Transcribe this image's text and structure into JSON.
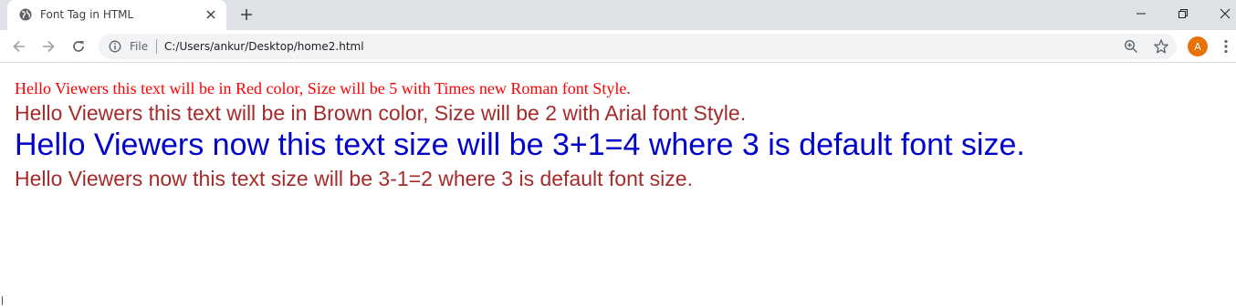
{
  "browser": {
    "tab": {
      "title": "Font Tag in HTML",
      "favicon": "globe-icon"
    },
    "toolbar": {
      "scheme_label": "File",
      "url": "C:/Users/ankur/Desktop/home2.html",
      "avatar_initial": "A",
      "avatar_color": "#e8710a"
    }
  },
  "page": {
    "lines": [
      {
        "text": "Hello Viewers this text will be in Red color, Size will be 5 with Times new Roman font Style.",
        "color": "#ff0000"
      },
      {
        "text": "Hello Viewers this text will be in Brown color, Size will be 2 with Arial font Style.",
        "color": "#a52a2a"
      },
      {
        "text": "Hello Viewers now this text size will be 3+1=4 where 3 is default font size.",
        "color": "#0000cd"
      },
      {
        "text": "Hello Viewers now this text size will be 3-1=2 where 3 is default font size.",
        "color": "#a52a2a"
      }
    ]
  }
}
